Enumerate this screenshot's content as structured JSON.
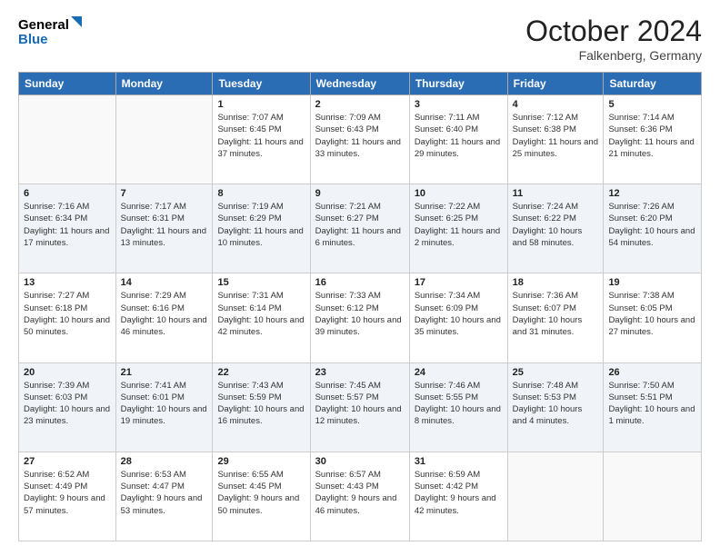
{
  "header": {
    "title": "October 2024",
    "location": "Falkenberg, Germany",
    "logo_line1": "General",
    "logo_line2": "Blue"
  },
  "days_of_week": [
    "Sunday",
    "Monday",
    "Tuesday",
    "Wednesday",
    "Thursday",
    "Friday",
    "Saturday"
  ],
  "weeks": [
    [
      {
        "day": "",
        "info": ""
      },
      {
        "day": "",
        "info": ""
      },
      {
        "day": "1",
        "info": "Sunrise: 7:07 AM\nSunset: 6:45 PM\nDaylight: 11 hours and 37 minutes."
      },
      {
        "day": "2",
        "info": "Sunrise: 7:09 AM\nSunset: 6:43 PM\nDaylight: 11 hours and 33 minutes."
      },
      {
        "day": "3",
        "info": "Sunrise: 7:11 AM\nSunset: 6:40 PM\nDaylight: 11 hours and 29 minutes."
      },
      {
        "day": "4",
        "info": "Sunrise: 7:12 AM\nSunset: 6:38 PM\nDaylight: 11 hours and 25 minutes."
      },
      {
        "day": "5",
        "info": "Sunrise: 7:14 AM\nSunset: 6:36 PM\nDaylight: 11 hours and 21 minutes."
      }
    ],
    [
      {
        "day": "6",
        "info": "Sunrise: 7:16 AM\nSunset: 6:34 PM\nDaylight: 11 hours and 17 minutes."
      },
      {
        "day": "7",
        "info": "Sunrise: 7:17 AM\nSunset: 6:31 PM\nDaylight: 11 hours and 13 minutes."
      },
      {
        "day": "8",
        "info": "Sunrise: 7:19 AM\nSunset: 6:29 PM\nDaylight: 11 hours and 10 minutes."
      },
      {
        "day": "9",
        "info": "Sunrise: 7:21 AM\nSunset: 6:27 PM\nDaylight: 11 hours and 6 minutes."
      },
      {
        "day": "10",
        "info": "Sunrise: 7:22 AM\nSunset: 6:25 PM\nDaylight: 11 hours and 2 minutes."
      },
      {
        "day": "11",
        "info": "Sunrise: 7:24 AM\nSunset: 6:22 PM\nDaylight: 10 hours and 58 minutes."
      },
      {
        "day": "12",
        "info": "Sunrise: 7:26 AM\nSunset: 6:20 PM\nDaylight: 10 hours and 54 minutes."
      }
    ],
    [
      {
        "day": "13",
        "info": "Sunrise: 7:27 AM\nSunset: 6:18 PM\nDaylight: 10 hours and 50 minutes."
      },
      {
        "day": "14",
        "info": "Sunrise: 7:29 AM\nSunset: 6:16 PM\nDaylight: 10 hours and 46 minutes."
      },
      {
        "day": "15",
        "info": "Sunrise: 7:31 AM\nSunset: 6:14 PM\nDaylight: 10 hours and 42 minutes."
      },
      {
        "day": "16",
        "info": "Sunrise: 7:33 AM\nSunset: 6:12 PM\nDaylight: 10 hours and 39 minutes."
      },
      {
        "day": "17",
        "info": "Sunrise: 7:34 AM\nSunset: 6:09 PM\nDaylight: 10 hours and 35 minutes."
      },
      {
        "day": "18",
        "info": "Sunrise: 7:36 AM\nSunset: 6:07 PM\nDaylight: 10 hours and 31 minutes."
      },
      {
        "day": "19",
        "info": "Sunrise: 7:38 AM\nSunset: 6:05 PM\nDaylight: 10 hours and 27 minutes."
      }
    ],
    [
      {
        "day": "20",
        "info": "Sunrise: 7:39 AM\nSunset: 6:03 PM\nDaylight: 10 hours and 23 minutes."
      },
      {
        "day": "21",
        "info": "Sunrise: 7:41 AM\nSunset: 6:01 PM\nDaylight: 10 hours and 19 minutes."
      },
      {
        "day": "22",
        "info": "Sunrise: 7:43 AM\nSunset: 5:59 PM\nDaylight: 10 hours and 16 minutes."
      },
      {
        "day": "23",
        "info": "Sunrise: 7:45 AM\nSunset: 5:57 PM\nDaylight: 10 hours and 12 minutes."
      },
      {
        "day": "24",
        "info": "Sunrise: 7:46 AM\nSunset: 5:55 PM\nDaylight: 10 hours and 8 minutes."
      },
      {
        "day": "25",
        "info": "Sunrise: 7:48 AM\nSunset: 5:53 PM\nDaylight: 10 hours and 4 minutes."
      },
      {
        "day": "26",
        "info": "Sunrise: 7:50 AM\nSunset: 5:51 PM\nDaylight: 10 hours and 1 minute."
      }
    ],
    [
      {
        "day": "27",
        "info": "Sunrise: 6:52 AM\nSunset: 4:49 PM\nDaylight: 9 hours and 57 minutes."
      },
      {
        "day": "28",
        "info": "Sunrise: 6:53 AM\nSunset: 4:47 PM\nDaylight: 9 hours and 53 minutes."
      },
      {
        "day": "29",
        "info": "Sunrise: 6:55 AM\nSunset: 4:45 PM\nDaylight: 9 hours and 50 minutes."
      },
      {
        "day": "30",
        "info": "Sunrise: 6:57 AM\nSunset: 4:43 PM\nDaylight: 9 hours and 46 minutes."
      },
      {
        "day": "31",
        "info": "Sunrise: 6:59 AM\nSunset: 4:42 PM\nDaylight: 9 hours and 42 minutes."
      },
      {
        "day": "",
        "info": ""
      },
      {
        "day": "",
        "info": ""
      }
    ]
  ]
}
